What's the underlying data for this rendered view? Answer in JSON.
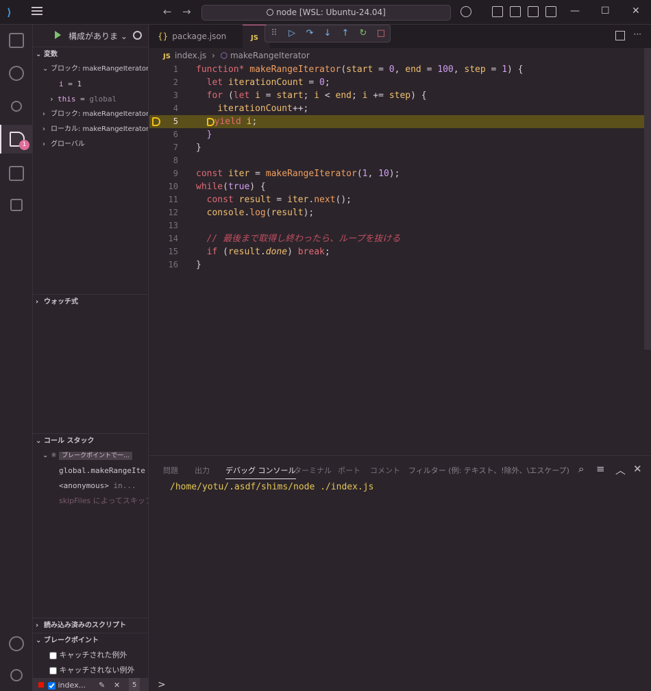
{
  "titlebar": {
    "search": "node [WSL: Ubuntu-24.04]"
  },
  "activity": {
    "debug_badge": "1"
  },
  "sidebar": {
    "config_label": "構成がありま",
    "variables_header": "変数",
    "var_items": [
      {
        "label": "ブロック: makeRangeIterator",
        "expanded": true
      },
      {
        "name": "i",
        "value": "1"
      },
      {
        "name": "this",
        "value": "global"
      },
      {
        "label": "ブロック: makeRangeIterator",
        "expanded": false
      },
      {
        "label": "ローカル: makeRangeIterator",
        "expanded": false
      },
      {
        "label": "グローバル",
        "expanded": false
      }
    ],
    "watch_header": "ウォッチ式",
    "callstack_header": "コール スタック",
    "callstack_thread": "ブレークポイントで一...",
    "callstack_frames": [
      {
        "name": "global.makeRangeIte",
        "file": ""
      },
      {
        "name": "<anonymous>",
        "file": "in..."
      },
      {
        "name": "skipFiles によってスキップさ",
        "file": ""
      }
    ],
    "loaded_scripts_header": "読み込み済みのスクリプト",
    "breakpoints_header": "ブレークポイント",
    "breakpoints": [
      {
        "label": "キャッチされた例外",
        "checked": false
      },
      {
        "label": "キャッチされない例外",
        "checked": false
      },
      {
        "label": "index...",
        "checked": true,
        "count": "5"
      }
    ]
  },
  "editor": {
    "tabs": [
      {
        "label": "package.json",
        "badge": "{}"
      },
      {
        "label": "JS",
        "badge": ""
      }
    ],
    "breadcrumb": {
      "file": "index.js",
      "symbol": "makeRangeIterator"
    },
    "current_line": 5
  },
  "panel": {
    "tabs": [
      "問題",
      "出力",
      "デバッグ コンソール",
      "ターミナル",
      "ポート",
      "コメント"
    ],
    "active_tab": "デバッグ コンソール",
    "filter_placeholder": "フィルター (例: テキスト、!除外、\\エスケープ)",
    "console_line": "/home/yotu/.asdf/shims/node ./index.js",
    "prompt": ">"
  }
}
